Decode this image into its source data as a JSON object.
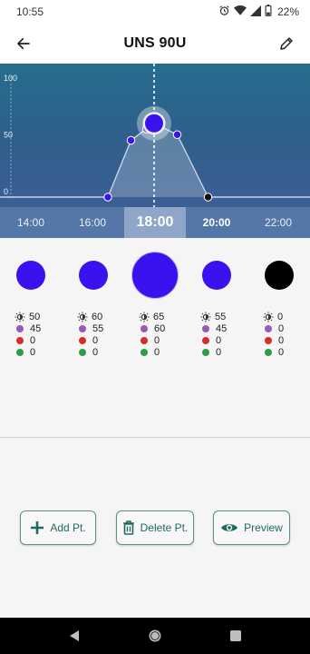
{
  "status_bar": {
    "time": "10:55",
    "battery": "22%"
  },
  "header": {
    "title": "UNS 90U"
  },
  "chart_data": {
    "type": "line",
    "y_ticks": [
      "100",
      "50",
      "0"
    ],
    "ylim": [
      0,
      100
    ],
    "x_labels": [
      "14:00",
      "16:00",
      "18:00",
      "20:00",
      "22:00"
    ],
    "selected_time": "18:00",
    "points": [
      {
        "x": 16.5,
        "y": 0
      },
      {
        "x": 17.25,
        "y": 50
      },
      {
        "x": 17.75,
        "y": 60
      },
      {
        "x": 18.0,
        "y": 65,
        "selected": true
      },
      {
        "x": 18.75,
        "y": 55
      },
      {
        "x": 19.75,
        "y": 0,
        "dark": true
      }
    ],
    "line_color": "#c9d4ea",
    "point_color": "#3a12f0",
    "grid": false
  },
  "columns": [
    {
      "color": "#3a12f0",
      "size": 32,
      "values": [
        "50",
        "45",
        "0",
        "0"
      ]
    },
    {
      "color": "#3a12f0",
      "size": 32,
      "values": [
        "60",
        "55",
        "0",
        "0"
      ]
    },
    {
      "color": "#3a12f0",
      "size": 52,
      "values": [
        "65",
        "60",
        "0",
        "0"
      ]
    },
    {
      "color": "#3a12f0",
      "size": 32,
      "values": [
        "55",
        "45",
        "0",
        "0"
      ]
    },
    {
      "color": "#000000",
      "size": 32,
      "values": [
        "0",
        "0",
        "0",
        "0"
      ]
    }
  ],
  "channel_colors": [
    "#333333",
    "#9b59b6",
    "#d32f2f",
    "#2e9d4a"
  ],
  "buttons": {
    "add": "Add Pt.",
    "delete": "Delete Pt.",
    "preview": "Preview"
  },
  "accent": "#1e6a63"
}
